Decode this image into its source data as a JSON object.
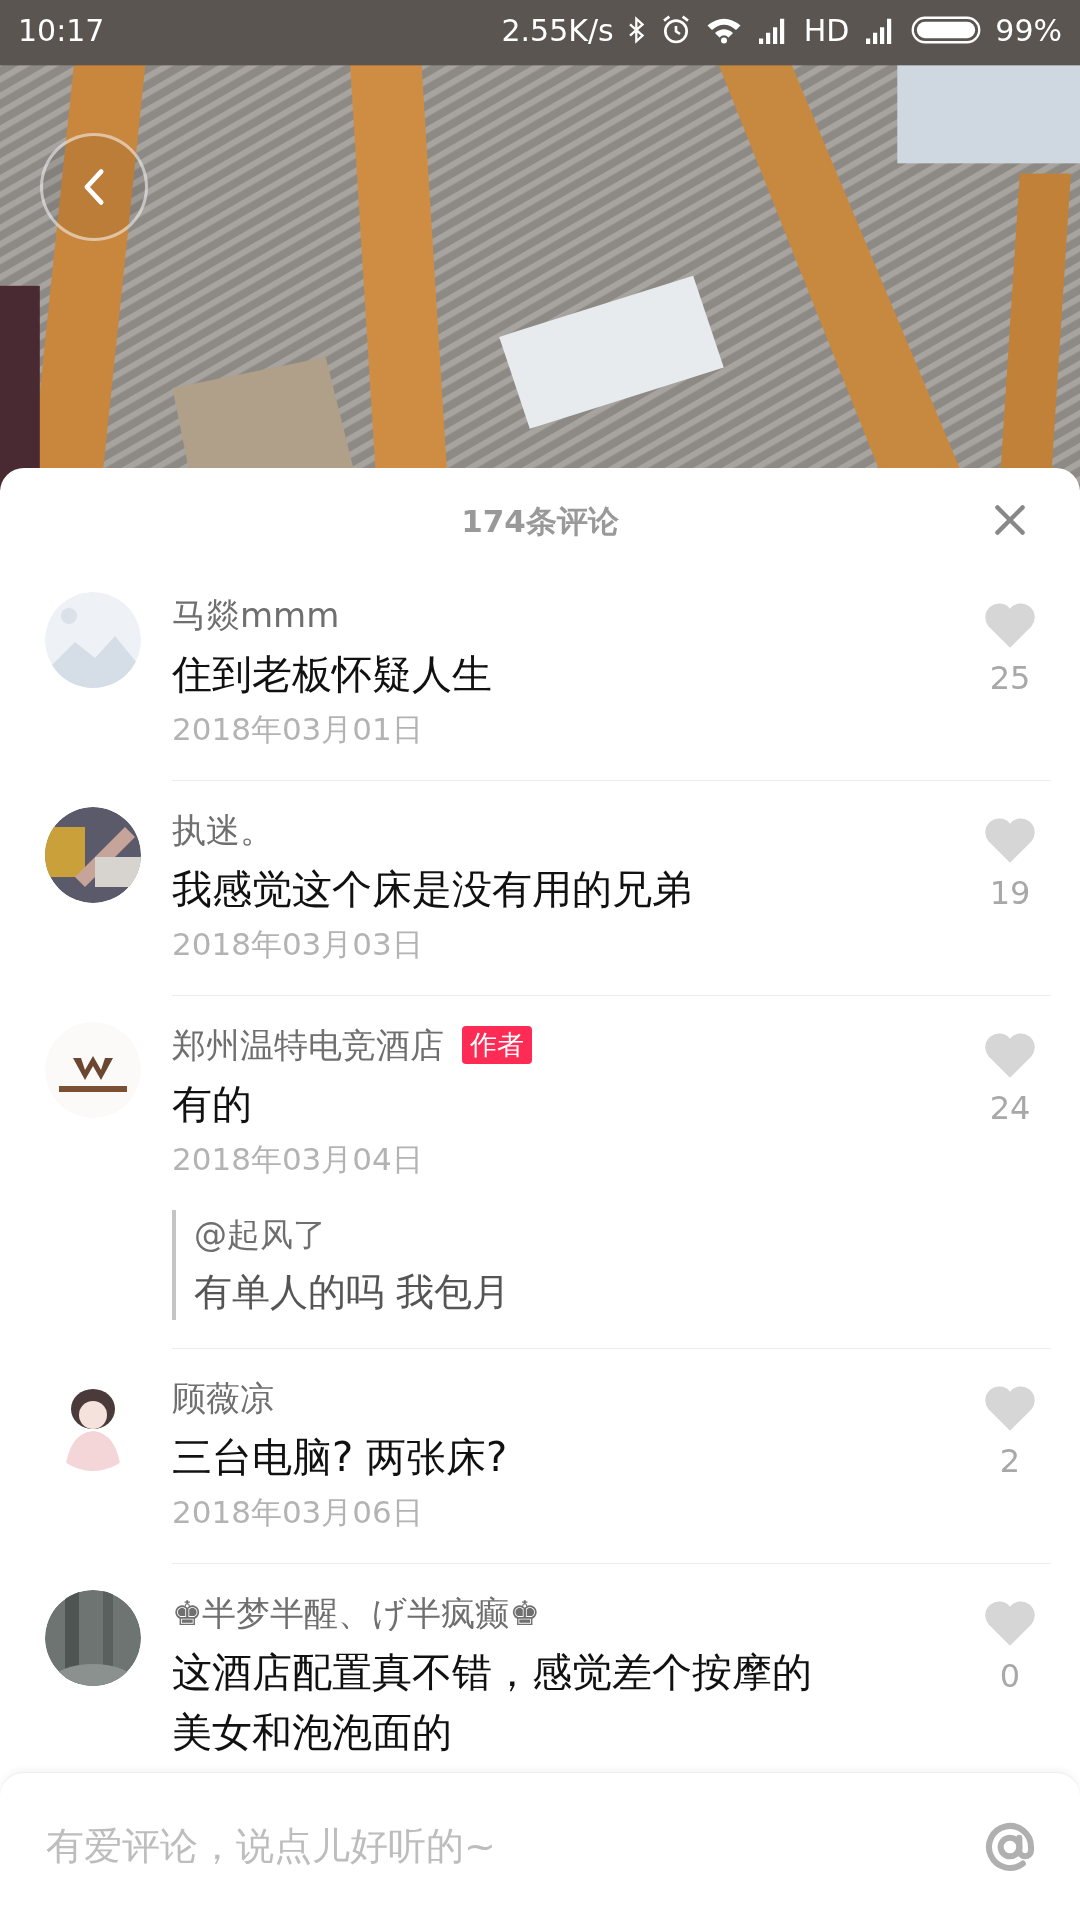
{
  "status_bar": {
    "time": "10:17",
    "net_speed": "2.55K/s",
    "network": "HD",
    "battery": "99%"
  },
  "comments_header": {
    "title": "174条评论"
  },
  "comments": [
    {
      "name": "马燚mmm",
      "text": "住到老板怀疑人生",
      "date": "2018年03月01日",
      "likes": "25",
      "liked": false
    },
    {
      "name": "执迷。",
      "text": "我感觉这个床是没有用的兄弟",
      "date": "2018年03月03日",
      "likes": "19",
      "liked": false
    },
    {
      "name": "郑州温特电竞酒店",
      "badge": "作者",
      "text": "有的",
      "date": "2018年03月04日",
      "likes": "24",
      "liked": false,
      "reply": {
        "mention": "@起风了",
        "text": "有单人的吗 我包月"
      }
    },
    {
      "name": "顾薇凉",
      "text": "三台电脑? 两张床?",
      "date": "2018年03月06日",
      "likes": "2",
      "liked": false
    },
    {
      "name": "♚半梦半醒、げ半疯癫♚",
      "text": "这酒店配置真不错，感觉差个按摩的美女和泡泡面的",
      "likes": "0",
      "liked": false
    }
  ],
  "input": {
    "placeholder": "有爱评论，说点儿好听的~"
  }
}
